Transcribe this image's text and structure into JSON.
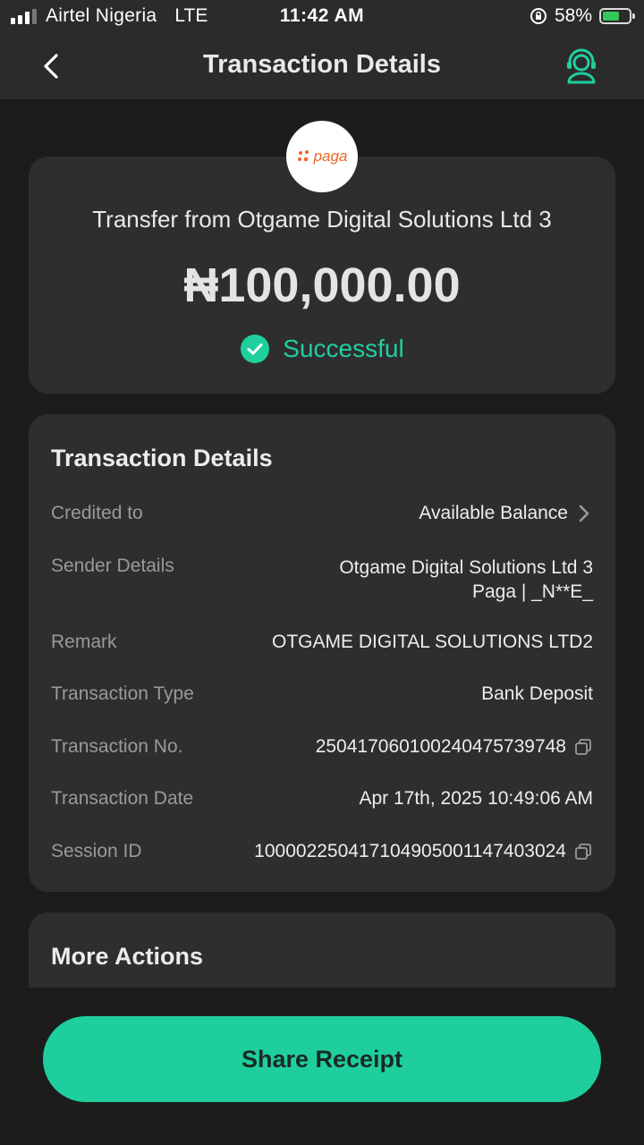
{
  "status_bar": {
    "carrier": "Airtel Nigeria",
    "network": "LTE",
    "time": "11:42 AM",
    "battery": "58%",
    "battery_level": 0.58
  },
  "header": {
    "title": "Transaction Details",
    "back_icon": "chevron-left-icon",
    "support_icon": "headset-support-icon"
  },
  "summary": {
    "logo_text": "paga",
    "description": "Transfer from Otgame Digital Solutions Ltd 3",
    "amount": "₦100,000.00",
    "status": "Successful",
    "status_color": "#1fcf9e"
  },
  "details": {
    "heading": "Transaction Details",
    "rows": [
      {
        "label": "Credited to",
        "value": "Available Balance"
      },
      {
        "label": "Sender Details",
        "value_line1": "Otgame Digital Solutions Ltd 3",
        "value_line2": "Paga | _N**E_"
      },
      {
        "label": "Remark",
        "value": "OTGAME DIGITAL SOLUTIONS LTD2"
      },
      {
        "label": "Transaction Type",
        "value": "Bank Deposit"
      },
      {
        "label": "Transaction No.",
        "value": "250417060100240475739748"
      },
      {
        "label": "Transaction Date",
        "value": "Apr 17th, 2025 10:49:06 AM"
      },
      {
        "label": "Session ID",
        "value": "100002250417104905001147403024"
      }
    ]
  },
  "more_actions": {
    "heading": "More Actions"
  },
  "share_button": {
    "label": "Share Receipt",
    "color": "#1ecf9d"
  }
}
